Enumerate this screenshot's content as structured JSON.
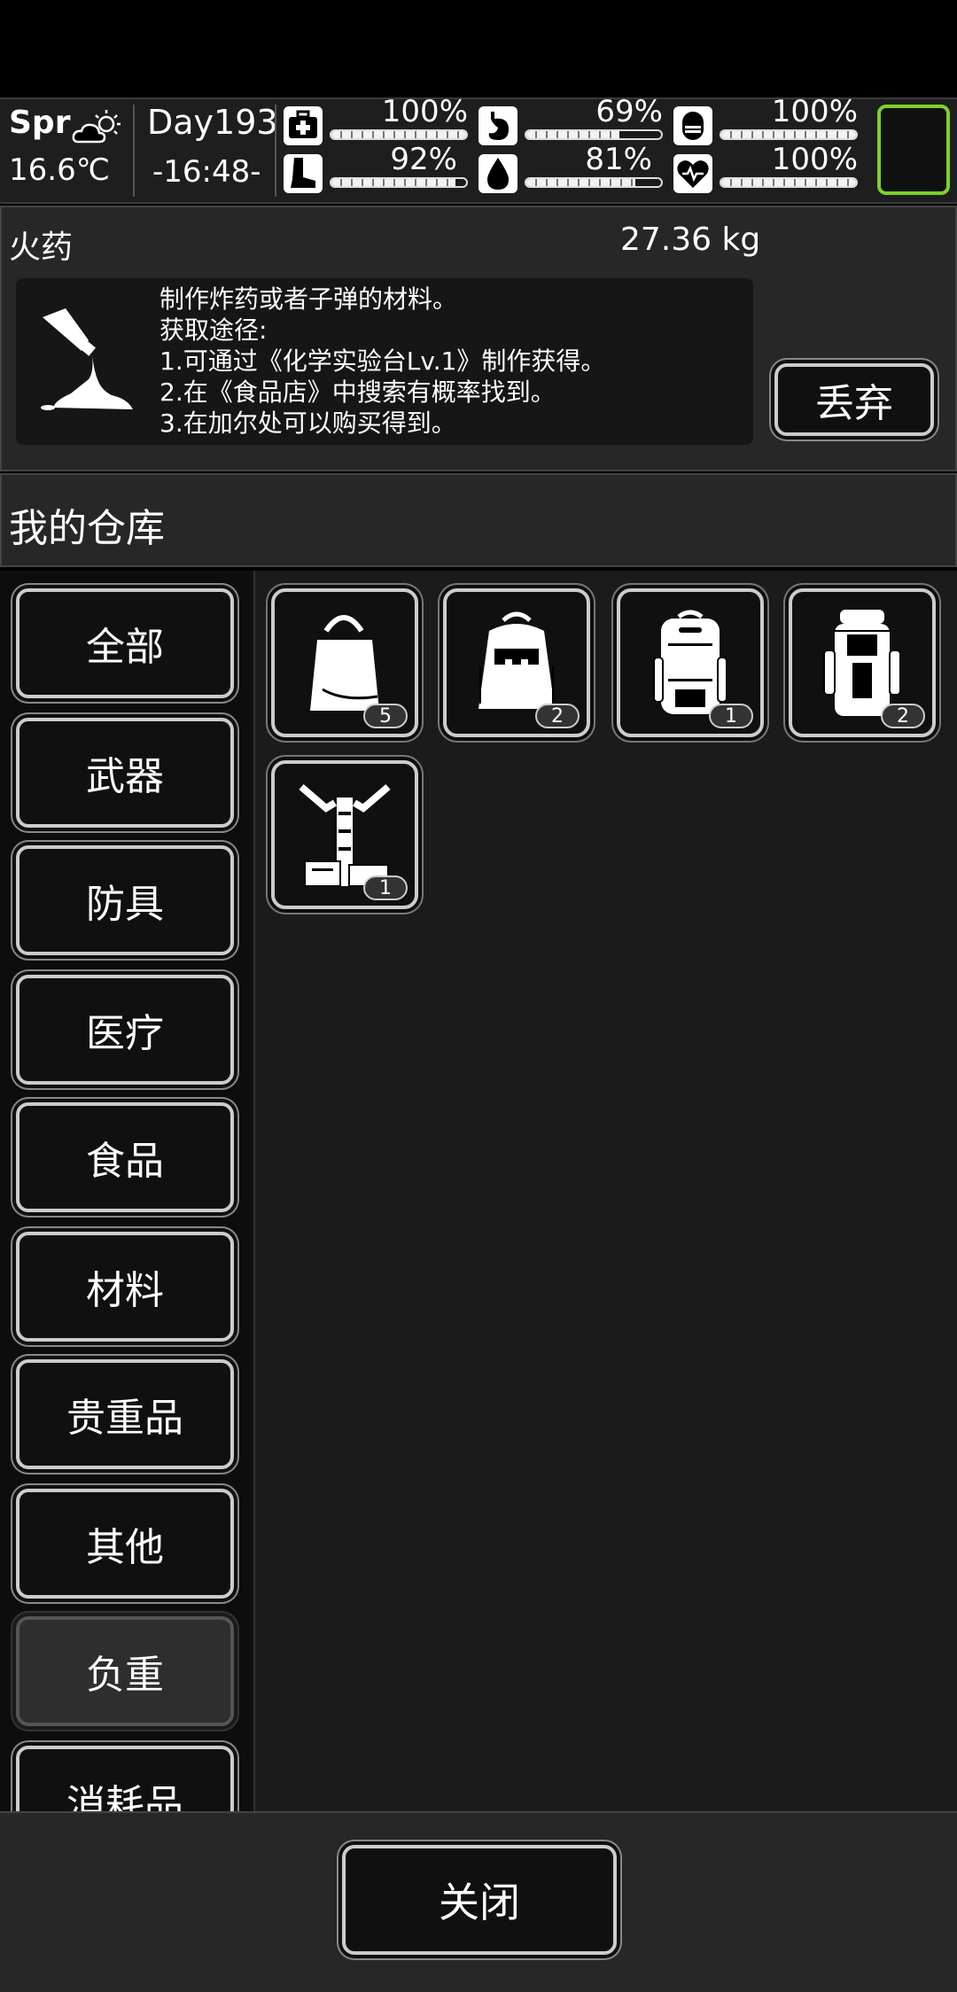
{
  "header": {
    "season": "Spr",
    "temperature": "16.6℃",
    "day": "Day193",
    "clock": "-16:48-",
    "stats": [
      {
        "icon": "medkit-icon",
        "percent_label": "100%",
        "value": 1.0
      },
      {
        "icon": "stomach-icon",
        "percent_label": "69%",
        "value": 0.69
      },
      {
        "icon": "capsule-icon",
        "percent_label": "100%",
        "value": 1.0
      },
      {
        "icon": "boot-icon",
        "percent_label": "92%",
        "value": 0.92
      },
      {
        "icon": "water-drop-icon",
        "percent_label": "81%",
        "value": 0.81
      },
      {
        "icon": "heart-icon",
        "percent_label": "100%",
        "value": 1.0
      }
    ]
  },
  "detail": {
    "name": "火药",
    "weight": "27.36 kg",
    "description": "制作炸药或者子弹的材料。\n获取途径:\n1.可通过《化学实验台Lv.1》制作获得。\n2.在《食品店》中搜索有概率找到。\n3.在加尔处可以购买得到。",
    "discard_label": "丢弃"
  },
  "warehouse": {
    "title": "我的仓库",
    "categories": [
      {
        "label": "全部",
        "active": false
      },
      {
        "label": "武器",
        "active": false
      },
      {
        "label": "防具",
        "active": false
      },
      {
        "label": "医疗",
        "active": false
      },
      {
        "label": "食品",
        "active": false
      },
      {
        "label": "材料",
        "active": false
      },
      {
        "label": "贵重品",
        "active": false
      },
      {
        "label": "其他",
        "active": false
      },
      {
        "label": "负重",
        "active": true
      },
      {
        "label": "消耗品",
        "active": false
      }
    ],
    "items": [
      {
        "icon": "tote-bag-icon",
        "count": "5"
      },
      {
        "icon": "small-backpack-icon",
        "count": "2"
      },
      {
        "icon": "backpack-icon",
        "count": "1"
      },
      {
        "icon": "hiking-backpack-icon",
        "count": "2"
      },
      {
        "icon": "cargo-frame-icon",
        "count": "1"
      }
    ]
  },
  "footer": {
    "close_label": "关闭"
  }
}
